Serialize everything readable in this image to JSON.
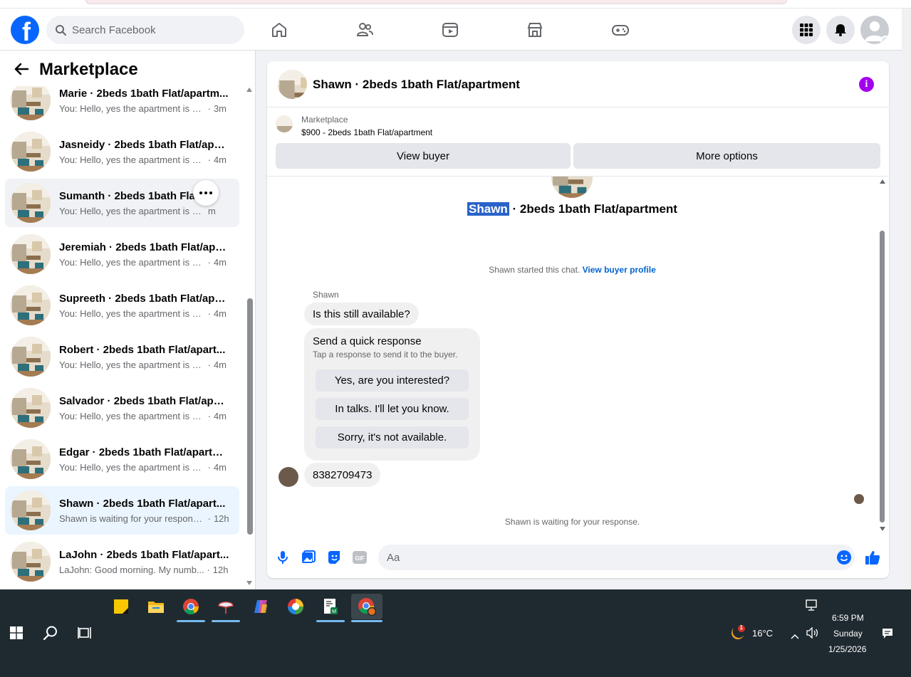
{
  "topnav": {
    "logo": "f",
    "search_placeholder": "Search Facebook"
  },
  "marketplace": {
    "title": "Marketplace",
    "conversations": [
      {
        "name": "Marie · 2beds 1bath Flat/apartm...",
        "preview": "You: Hello, yes the apartment is stil...",
        "time": "3m",
        "state": "partial"
      },
      {
        "name": "Jasneidy · 2beds 1bath Flat/apar...",
        "preview": "You: Hello, yes the apartment is stil...",
        "time": "4m",
        "state": "normal"
      },
      {
        "name": "Sumanth · 2beds 1bath Flat/a...",
        "preview": "You: Hello, yes the apartment is st...",
        "time": "m",
        "state": "hover"
      },
      {
        "name": "Jeremiah · 2beds 1bath Flat/apar...",
        "preview": "You: Hello, yes the apartment is stil...",
        "time": "4m",
        "state": "normal"
      },
      {
        "name": "Supreeth · 2beds 1bath Flat/apar...",
        "preview": "You: Hello, yes the apartment is stil...",
        "time": "4m",
        "state": "normal"
      },
      {
        "name": "Robert · 2beds 1bath Flat/apart...",
        "preview": "You: Hello, yes the apartment is stil...",
        "time": "4m",
        "state": "normal"
      },
      {
        "name": "Salvador · 2beds 1bath Flat/apar...",
        "preview": "You: Hello, yes the apartment is stil...",
        "time": "4m",
        "state": "normal"
      },
      {
        "name": "Edgar · 2beds 1bath Flat/apartm...",
        "preview": "You: Hello, yes the apartment is stil...",
        "time": "4m",
        "state": "normal"
      },
      {
        "name": "Shawn · 2beds 1bath Flat/apart...",
        "preview": "Shawn is waiting for your response.",
        "time": "12h",
        "state": "active"
      },
      {
        "name": "LaJohn · 2beds 1bath Flat/apart...",
        "preview": "LaJohn: Good morning. My numb...",
        "time": "12h",
        "state": "normal"
      }
    ]
  },
  "chat": {
    "title": "Shawn · 2beds 1bath Flat/apartment",
    "listing_source": "Marketplace",
    "listing_price": "$900 - 2beds 1bath Flat/apartment",
    "view_buyer": "View buyer",
    "more_options": "More options",
    "big_title_selected": "Shawn",
    "big_title_rest": " · 2beds 1bath Flat/apartment",
    "started_text": "Shawn started this chat.",
    "view_buyer_profile": "View buyer profile",
    "sender_name": "Shawn",
    "first_message": "Is this still available?",
    "quick_title": "Send a quick response",
    "quick_subtitle": "Tap a response to send it to the buyer.",
    "quick_responses": [
      "Yes, are you interested?",
      "In talks. I'll let you know.",
      "Sorry, it's not available."
    ],
    "second_message": "8382709473",
    "waiting_text": "Shawn is waiting for your response.",
    "composer_placeholder": "Aa",
    "gif_label": "GIF"
  },
  "taskbar": {
    "weather_temp": "16°C",
    "weather_badge": "1",
    "time": "6:59 PM",
    "day": "Sunday",
    "date": "1/25/2026"
  },
  "colors": {
    "facebook_blue": "#0866ff",
    "link_blue": "#0064d1",
    "info_purple": "#a400f0",
    "active_row": "#ebf5ff",
    "taskbar": "#1f2a30"
  }
}
